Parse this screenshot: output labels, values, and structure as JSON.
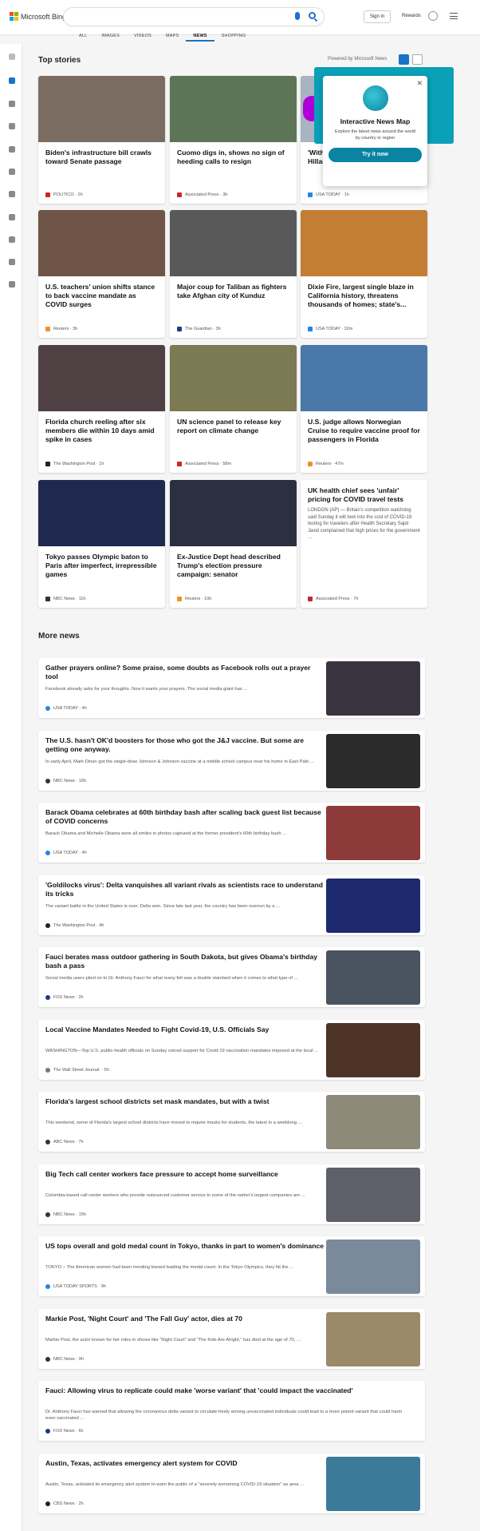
{
  "brand": "Microsoft Bing",
  "header": {
    "signin": "Sign in",
    "rewards": "Rewards"
  },
  "nav": [
    "ALL",
    "IMAGES",
    "VIDEOS",
    "MAPS",
    "NEWS",
    "SHOPPING"
  ],
  "top": {
    "title": "Top stories",
    "powered": "Powered by Microsoft News"
  },
  "more_title": "More news",
  "cards": [
    {
      "title": "Biden's infrastructure bill crawls toward Senate passage",
      "src": "POLITICO · 2h",
      "img": "#7b6c62",
      "icon": "#c62828"
    },
    {
      "title": "Cuomo digs in, shows no sign of heeding calls to resign",
      "src": "Associated Press · 3h",
      "img": "#5e7457",
      "icon": "#c62828"
    },
    {
      "title": "'With my back against the Ring', Hillary... to he...",
      "src": "USA TODAY · 1h",
      "img": "#a8b4c0",
      "icon": "#1e88e5"
    },
    {
      "title": "U.S. teachers' union shifts stance to back vaccine mandate as COVID surges",
      "src": "Reuters · 3h",
      "img": "#6e5548",
      "icon": "#ef8f2f"
    },
    {
      "title": "Major coup for Taliban as fighters take Afghan city of Kunduz",
      "src": "The Guardian · 3h",
      "img": "#59595a",
      "icon": "#1e3a8a"
    },
    {
      "title": "Dixie Fire, largest single blaze in California history, threatens thousands of homes; state's...",
      "src": "USA TODAY · 32m",
      "img": "#c27e34",
      "icon": "#1e88e5"
    },
    {
      "title": "Florida church reeling after six members die within 10 days amid spike in cases",
      "src": "The Washington Post · 1h",
      "img": "#4f4143",
      "icon": "#222"
    },
    {
      "title": "UN science panel to release key report on climate change",
      "src": "Associated Press · 58m",
      "img": "#7c7a52",
      "icon": "#c62828"
    },
    {
      "title": "U.S. judge allows Norwegian Cruise to require vaccine proof for passengers in Florida",
      "src": "Reuters · 47m",
      "img": "#4a78a8",
      "icon": "#ef8f2f"
    },
    {
      "title": "Tokyo passes Olympic baton to Paris after imperfect, irrepressible games",
      "src": "NBC News · 11h",
      "img": "#1f2950",
      "icon": "#333"
    },
    {
      "title": "Ex-Justice Dept head described Trump's election pressure campaign: senator",
      "src": "Reuters · 10h",
      "img": "#2a3040",
      "icon": "#ef8f2f"
    }
  ],
  "text_card": {
    "title": "UK health chief sees 'unfair' pricing for COVID travel tests",
    "body": "LONDON (AP) — Britain's competition watchdog said Sunday it will look into the cost of COVID-19 testing for travelers after Health Secretary Sajid Javid complained that high prices for the government ...",
    "src": "Associated Press · 7h"
  },
  "popup": {
    "title": "Interactive News Map",
    "body": "Explore the latest news around the world by country or region",
    "button": "Try it now"
  },
  "more": [
    {
      "title": "Gather prayers online? Some praise, some doubts as Facebook rolls out a prayer tool",
      "body": "Facebook already asks for your thoughts. Now it wants your prayers. The social media giant has ...",
      "src": "USA TODAY · 4h",
      "img": "#3a3440",
      "icon": "#1e88e5"
    },
    {
      "title": "The U.S. hasn't OK'd boosters for those who got the J&J vaccine. But some are getting one anyway.",
      "body": "In early April, Mark Dinan got the single-dose Johnson & Johnson vaccine at a middle school campus near his home in East Palo ...",
      "src": "NBC News · 16h",
      "img": "#2b2b2b",
      "icon": "#333"
    },
    {
      "title": "Barack Obama celebrates at 60th birthday bash after scaling back guest list because of COVID concerns",
      "body": "Barack Obama and Michelle Obama were all smiles in photos captured at the former president's 60th birthday bash ...",
      "src": "USA TODAY · 4h",
      "img": "#8d3a3a",
      "icon": "#1e88e5"
    },
    {
      "title": "'Goldilocks virus': Delta vanquishes all variant rivals as scientists race to understand its tricks",
      "body": "The variant battle in the United States is over. Delta won. Since late last year, the country has been overrun by a ...",
      "src": "The Washington Post · 4h",
      "img": "#1e2a6e",
      "icon": "#222"
    },
    {
      "title": "Fauci berates mass outdoor gathering in South Dakota, but gives Obama's birthday bash a pass",
      "body": "Social media users piled on to Dr. Anthony Fauci for what many felt was a double standard when it comes to what type of ...",
      "src": "FOX News · 2h",
      "img": "#4a5360",
      "icon": "#1a3a8a"
    },
    {
      "title": "Local Vaccine Mandates Needed to Fight Covid-19, U.S. Officials Say",
      "body": "WASHINGTON—Top U.S. public-health officials on Sunday voiced support for Covid-19 vaccination mandates imposed at the local ...",
      "src": "The Wall Street Journal. · 5h",
      "img": "#4e3426",
      "icon": "#777"
    },
    {
      "title": "Florida's largest school districts set mask mandates, but with a twist",
      "body": "This weekend, some of Florida's largest school districts have moved to require masks for students, the latest in a weeklong ...",
      "src": "ABC News · 7h",
      "img": "#8d8a7a",
      "icon": "#333"
    },
    {
      "title": "Big Tech call center workers face pressure to accept home surveillance",
      "body": "Colombia-based call center workers who provide outsourced customer service to some of the nation's largest companies are ...",
      "src": "NBC News · 15h",
      "img": "#5d6068",
      "icon": "#333"
    },
    {
      "title": "US tops overall and gold medal count in Tokyo, thanks in part to women's dominance",
      "body": "TOKYO – The American women had been trending toward leading the medal count. In the Tokyo Olympics, they hit the ...",
      "src": "USA TODAY SPORTS · 9h",
      "img": "#7a8a9a",
      "icon": "#1e88e5"
    },
    {
      "title": "Markie Post, 'Night Court' and 'The Fall Guy' actor, dies at 70",
      "body": "Markie Post, the actor known for her roles in shows like \"Night Court\" and \"The Kids Are Alright,\" has died at the age of 70, ...",
      "src": "NBC News · 9h",
      "img": "#9a8a6a",
      "icon": "#333"
    },
    {
      "title": "Fauci: Allowing virus to replicate could make 'worse variant' that 'could impact the vaccinated'",
      "body": "Dr. Anthony Fauci has warned that allowing the coronavirus delta variant to circulate freely among unvaccinated individuals could lead to a more potent variant that could harm even vaccinated ...",
      "src": "FOX News · 6h",
      "img": "",
      "icon": "#1a3a8a"
    },
    {
      "title": "Austin, Texas, activates emergency alert system for COVID",
      "body": "Austin, Texas, activated its emergency alert system to warn the public of a \"severely worsening COVID-19 situation\" as area ...",
      "src": "CBS News · 2h",
      "img": "#3c7a9a",
      "icon": "#222"
    }
  ]
}
